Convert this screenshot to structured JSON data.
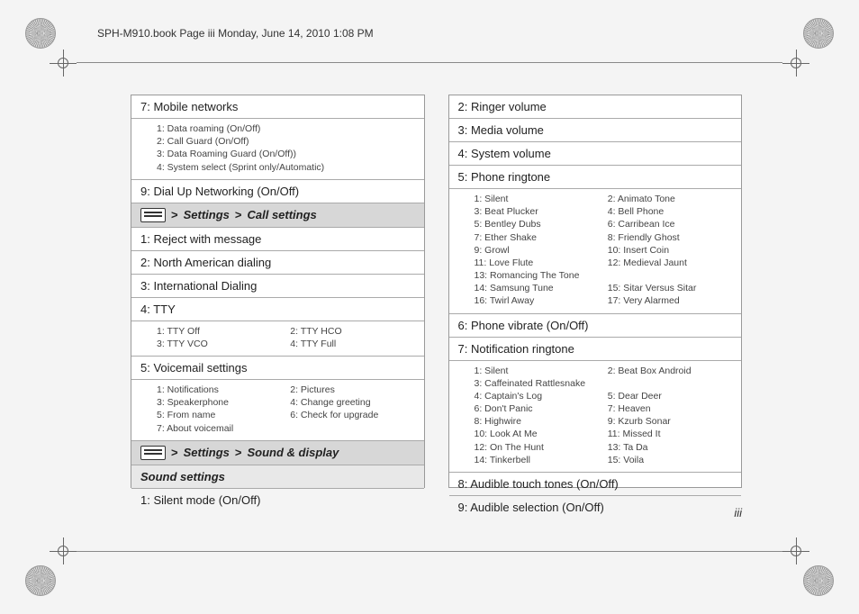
{
  "header": "SPH-M910.book  Page iii  Monday, June 14, 2010  1:08 PM",
  "page_number": "iii",
  "left": {
    "rows": [
      {
        "type": "row",
        "text": "7: Mobile networks"
      },
      {
        "type": "sub_list",
        "items": [
          "1: Data roaming (On/Off)",
          "2: Call Guard (On/Off)",
          "3: Data Roaming Guard (On/Off))",
          "4: System select (Sprint only/Automatic)"
        ]
      },
      {
        "type": "row",
        "text": "9: Dial Up Networking (On/Off)"
      },
      {
        "type": "header",
        "parts": [
          "Settings",
          "Call settings"
        ]
      },
      {
        "type": "row",
        "text": "1: Reject with message"
      },
      {
        "type": "row",
        "text": "2: North American dialing"
      },
      {
        "type": "row",
        "text": "3: International Dialing"
      },
      {
        "type": "row",
        "text": "4: TTY"
      },
      {
        "type": "sub_grid",
        "items": [
          "1: TTY Off",
          "2: TTY HCO",
          "3: TTY VCO",
          "4: TTY Full"
        ]
      },
      {
        "type": "row",
        "text": "5: Voicemail settings"
      },
      {
        "type": "sub_grid",
        "items": [
          "1: Notifications",
          "2: Pictures",
          "3: Speakerphone",
          "4: Change greeting",
          "5: From name",
          "6: Check for upgrade",
          "7: About voicemail",
          ""
        ]
      },
      {
        "type": "header",
        "parts": [
          "Settings",
          "Sound & display"
        ]
      },
      {
        "type": "subheader",
        "text": "Sound settings"
      },
      {
        "type": "row",
        "text": "1: Silent mode (On/Off)"
      }
    ]
  },
  "right": {
    "rows": [
      {
        "type": "row",
        "text": "2: Ringer volume"
      },
      {
        "type": "row",
        "text": "3: Media volume"
      },
      {
        "type": "row",
        "text": "4: System volume"
      },
      {
        "type": "row",
        "text": "5: Phone ringtone"
      },
      {
        "type": "sub_grid",
        "items": [
          "1: Silent",
          "2: Animato Tone",
          "3: Beat Plucker",
          "4: Bell Phone",
          "5: Bentley Dubs",
          "6: Carribean Ice",
          "7: Ether Shake",
          "8: Friendly Ghost",
          "9: Growl",
          "10: Insert Coin",
          "11: Love Flute",
          "12: Medieval Jaunt",
          "13: Romancing The Tone",
          "",
          "14: Samsung Tune",
          "15: Sitar Versus Sitar",
          "16: Twirl Away",
          "17: Very Alarmed"
        ]
      },
      {
        "type": "row",
        "text": "6: Phone vibrate (On/Off)"
      },
      {
        "type": "row",
        "text": "7: Notification ringtone"
      },
      {
        "type": "sub_grid",
        "items": [
          "1: Silent",
          "2: Beat Box Android",
          "3: Caffeinated Rattlesnake",
          "",
          "4: Captain's Log",
          "5: Dear Deer",
          "6: Don't Panic",
          "7: Heaven",
          "8: Highwire",
          "9: Kzurb Sonar",
          "10: Look At Me",
          "11: Missed It",
          "12: On The Hunt",
          "13: Ta Da",
          "14: Tinkerbell",
          "15: Voila"
        ]
      },
      {
        "type": "row",
        "text": "8: Audible touch tones (On/Off)"
      },
      {
        "type": "row",
        "text": "9: Audible selection (On/Off)"
      }
    ]
  }
}
